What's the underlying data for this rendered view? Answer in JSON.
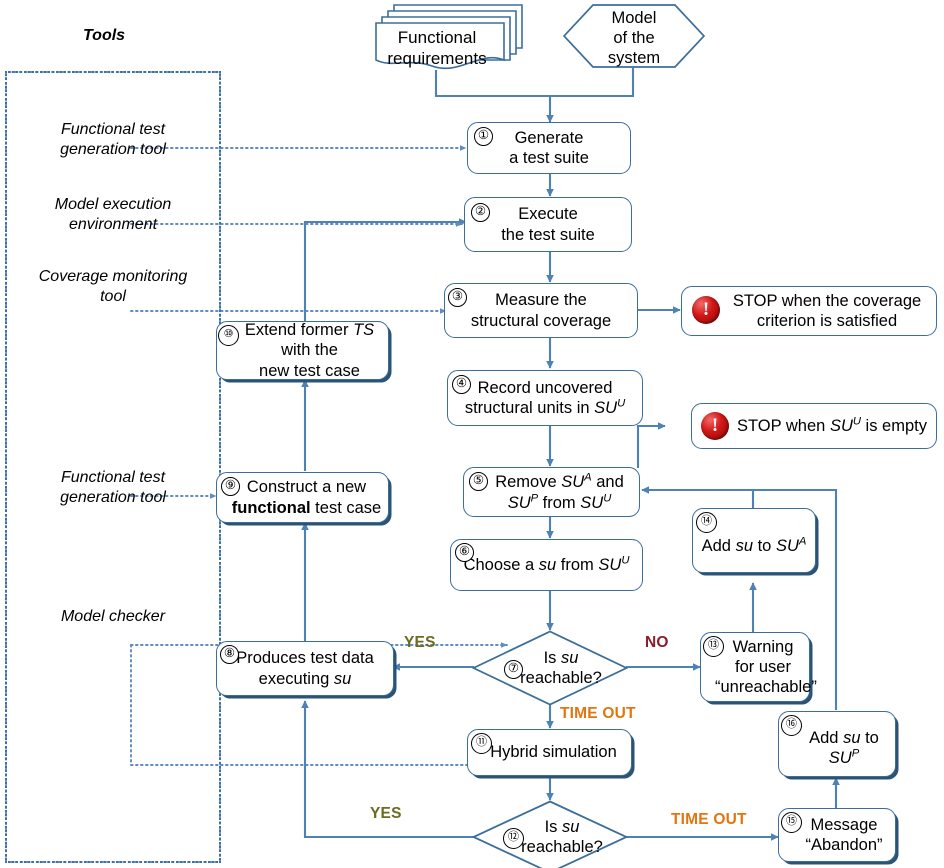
{
  "title": "Combined functional and structural test generation workflow",
  "colors": {
    "node_border": "#3b6e9b",
    "wire": "#4e82b4",
    "dotted": "#3f6fa5",
    "yes": "#6c6b21",
    "no": "#8c1c2b",
    "timeout": "#e2750f",
    "stop_red": "#d41717"
  },
  "tools_panel": {
    "heading": "Tools",
    "items": [
      {
        "id": "tool-functional-test-gen-1",
        "lines": [
          "Functional test",
          "generation tool"
        ]
      },
      {
        "id": "tool-model-execution-env",
        "lines": [
          "Model execution",
          "environment"
        ]
      },
      {
        "id": "tool-coverage-monitoring",
        "lines": [
          "Coverage monitoring",
          "tool"
        ]
      },
      {
        "id": "tool-functional-test-gen-2",
        "lines": [
          "Functional test",
          "generation tool"
        ]
      },
      {
        "id": "tool-model-checker",
        "lines": [
          "Model checker"
        ]
      }
    ]
  },
  "inputs": {
    "requirements": {
      "lines": [
        "Functional",
        "requirements"
      ]
    },
    "model": {
      "lines": [
        "Model",
        "of the",
        "system"
      ]
    }
  },
  "nodes": [
    {
      "id": "n1",
      "number": "①",
      "lines": [
        "Generate",
        "a test suite"
      ]
    },
    {
      "id": "n2",
      "number": "②",
      "lines": [
        "Execute",
        "the test suite"
      ]
    },
    {
      "id": "n3",
      "number": "③",
      "lines": [
        "Measure the",
        "structural coverage"
      ]
    },
    {
      "id": "n4",
      "number": "④",
      "lines": [
        "Record uncovered",
        "structural units in SU<sup>U</sup>"
      ]
    },
    {
      "id": "n5",
      "number": "⑤",
      "lines": [
        "Remove  SU<sup>A</sup> and",
        "SU<sup>P</sup> from SU<sup>U</sup>"
      ]
    },
    {
      "id": "n6",
      "number": "⑥",
      "lines": [
        "Choose a su from SU<sup>U</sup>"
      ]
    },
    {
      "id": "n7",
      "number": "⑦",
      "lines": [
        "Is su",
        "reachable?"
      ]
    },
    {
      "id": "n8",
      "number": "⑧",
      "lines": [
        "Produces  test data",
        "executing  su"
      ]
    },
    {
      "id": "n9",
      "number": "⑨",
      "lines": [
        "Construct  a new",
        "functional test case"
      ]
    },
    {
      "id": "n10",
      "number": "⑩",
      "lines": [
        "Extend former TS",
        "with the",
        "new test case"
      ]
    },
    {
      "id": "n11",
      "number": "⑪",
      "lines": [
        "Hybrid simulation"
      ]
    },
    {
      "id": "n12",
      "number": "⑫",
      "lines": [
        "Is  su",
        "reachable?"
      ]
    },
    {
      "id": "n13",
      "number": "⑬",
      "lines": [
        "Warning",
        "for user",
        "“unreachable”"
      ]
    },
    {
      "id": "n14",
      "number": "⑭",
      "lines": [
        "Add su to SU<sup>A</sup>"
      ]
    },
    {
      "id": "n15",
      "number": "⑮",
      "lines": [
        "Message",
        "“Abandon”"
      ]
    },
    {
      "id": "n16",
      "number": "⑯",
      "lines": [
        "Add su to",
        "SU<sup>P</sup>"
      ]
    }
  ],
  "stops": [
    {
      "id": "stop-coverage",
      "lines": [
        "STOP when the coverage",
        "criterion is satisfied"
      ]
    },
    {
      "id": "stop-empty",
      "lines": [
        "STOP when SU<sup>U</sup> is empty"
      ]
    }
  ],
  "edge_labels": [
    {
      "id": "label-yes-7",
      "text": "YES",
      "kind": "yes"
    },
    {
      "id": "label-no-7",
      "text": "NO",
      "kind": "no"
    },
    {
      "id": "label-timeout-7",
      "text": "TIME OUT",
      "kind": "timeout"
    },
    {
      "id": "label-yes-12",
      "text": "YES",
      "kind": "yes"
    },
    {
      "id": "label-timeout-12",
      "text": "TIME OUT",
      "kind": "timeout"
    }
  ]
}
